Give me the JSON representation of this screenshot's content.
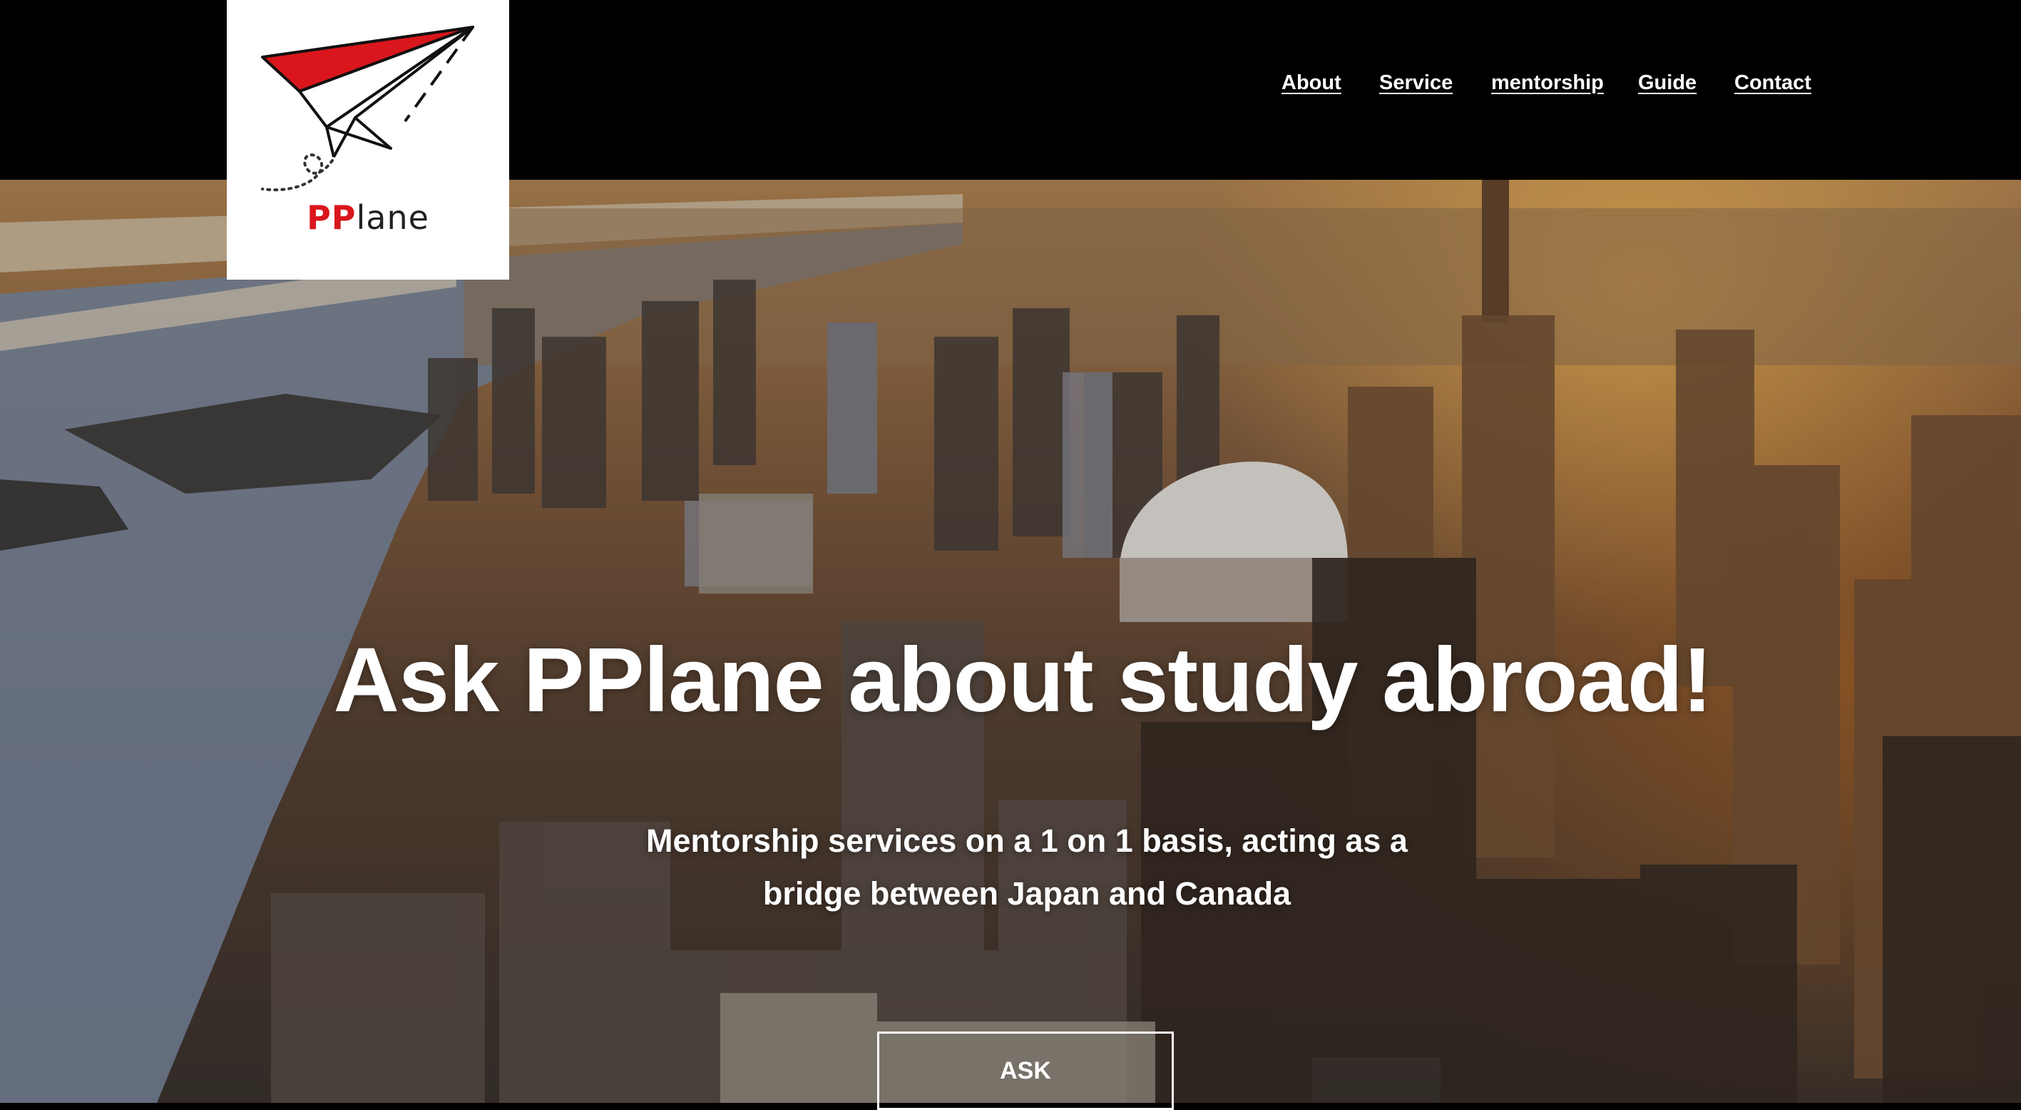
{
  "brand": {
    "logo_prefix": "PP",
    "logo_suffix": "lane"
  },
  "nav": {
    "items": [
      {
        "label": "About"
      },
      {
        "label": "Service"
      },
      {
        "label": "mentorship"
      },
      {
        "label": "Guide"
      },
      {
        "label": "Contact"
      }
    ]
  },
  "hero": {
    "headline": "Ask PPlane about study abroad!",
    "subline": "Mentorship services on a 1 on 1 basis, acting as a bridge between Japan and Canada",
    "cta_label": "ASK"
  },
  "colors": {
    "header_bg": "#000000",
    "logo_red": "#d9161c",
    "text": "#ffffff"
  }
}
